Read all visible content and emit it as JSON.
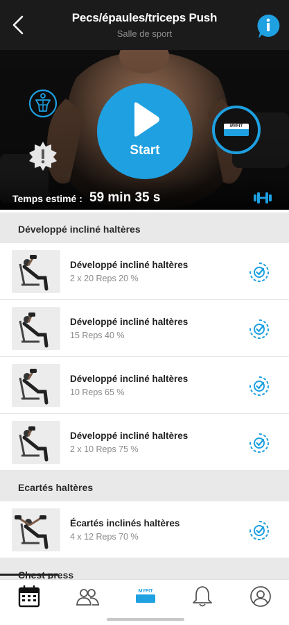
{
  "header": {
    "title": "Pecs/épaules/triceps  Push",
    "subtitle": "Salle de sport"
  },
  "hero": {
    "start_label": "Start",
    "estimated_label": "Temps estimé :",
    "estimated_value": "59 min 35 s",
    "mfit_logo_text": "MYFIT"
  },
  "sections": [
    {
      "title": "Développé incliné haltères",
      "items": [
        {
          "name": "Développé incliné haltères",
          "detail": "2 x 20 Reps 20 %"
        },
        {
          "name": "Développé incliné haltères",
          "detail": "15 Reps 40 %"
        },
        {
          "name": "Développé incliné haltères",
          "detail": "10 Reps 65 %"
        },
        {
          "name": "Développé incliné haltères",
          "detail": "2 x 10 Reps 75 %"
        }
      ]
    },
    {
      "title": "Ecartés haltères",
      "items": [
        {
          "name": "Écartés inclinés haltères",
          "detail": "4 x 12 Reps 70 %"
        }
      ]
    },
    {
      "title": "Chest press",
      "items": []
    }
  ],
  "bottom_nav": {
    "items": [
      "calendar-icon",
      "community-icon",
      "myfit-logo-icon",
      "bell-icon",
      "profile-icon"
    ],
    "logo_text": "MYFIT"
  },
  "colors": {
    "accent": "#1ea0e1",
    "header_bg": "#1b1b1b",
    "section_bg": "#e9e9e9"
  }
}
